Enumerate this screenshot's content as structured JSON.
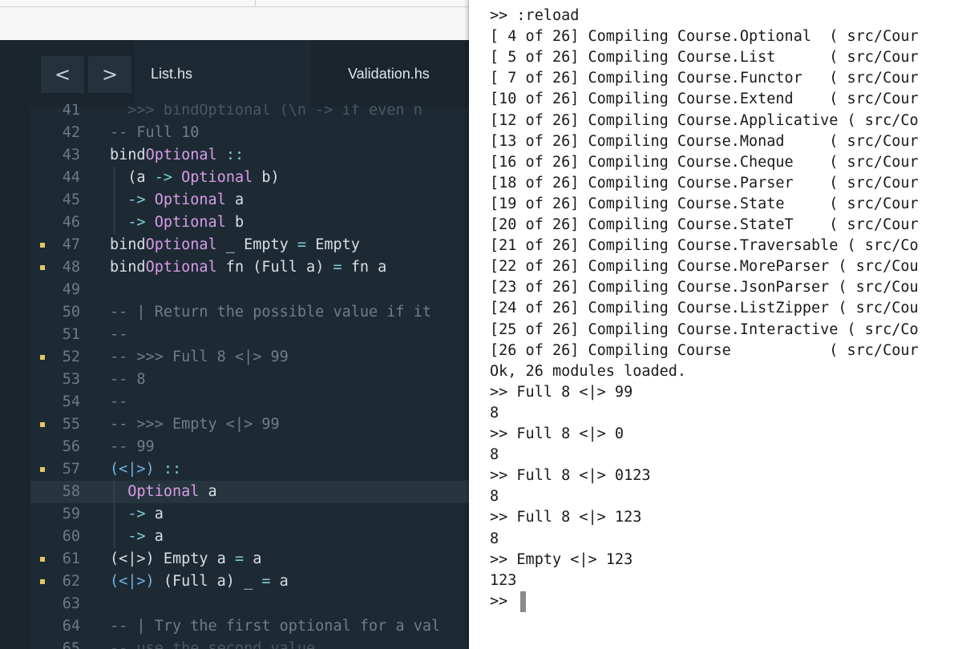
{
  "editor": {
    "nav": {
      "back": "<",
      "forward": ">"
    },
    "tabs": [
      {
        "label": "List.hs",
        "active": true
      },
      {
        "label": "Validation.hs",
        "active": false
      }
    ],
    "lines": [
      {
        "n": "41",
        "text": "  >>> bindOptional (\\n -> if even n",
        "partial": true
      },
      {
        "n": "42",
        "text": "-- Full 10"
      },
      {
        "n": "43",
        "text": "bindOptional ::"
      },
      {
        "n": "44",
        "text": "  (a -> Optional b)"
      },
      {
        "n": "45",
        "text": "  -> Optional a"
      },
      {
        "n": "46",
        "text": "  -> Optional b"
      },
      {
        "n": "47",
        "text": "bindOptional _ Empty = Empty",
        "mark": true
      },
      {
        "n": "48",
        "text": "bindOptional fn (Full a) = fn a",
        "mark": true
      },
      {
        "n": "49",
        "text": ""
      },
      {
        "n": "50",
        "text": "-- | Return the possible value if it"
      },
      {
        "n": "51",
        "text": "--"
      },
      {
        "n": "52",
        "text": "-- >>> Full 8 <|> 99",
        "mark": true
      },
      {
        "n": "53",
        "text": "-- 8"
      },
      {
        "n": "54",
        "text": "--"
      },
      {
        "n": "55",
        "text": "-- >>> Empty <|> 99",
        "mark": true
      },
      {
        "n": "56",
        "text": "-- 99"
      },
      {
        "n": "57",
        "text": "(<|>) ::",
        "mark": true
      },
      {
        "n": "58",
        "text": "  Optional a",
        "active": true
      },
      {
        "n": "59",
        "text": "  -> a"
      },
      {
        "n": "60",
        "text": "  -> a"
      },
      {
        "n": "61",
        "text": "(<|>) Empty a = a",
        "mark": true
      },
      {
        "n": "62",
        "text": "(<|>) (Full a) _ = a",
        "mark": true
      },
      {
        "n": "63",
        "text": ""
      },
      {
        "n": "64",
        "text": "-- | Try the first optional for a val"
      },
      {
        "n": "65",
        "text": "-- use the second value",
        "partial": true
      }
    ]
  },
  "terminal": {
    "lines": [
      ">> :reload",
      "[ 4 of 26] Compiling Course.Optional  ( src/Cour",
      "[ 5 of 26] Compiling Course.List      ( src/Cour",
      "[ 7 of 26] Compiling Course.Functor   ( src/Cour",
      "[10 of 26] Compiling Course.Extend    ( src/Cour",
      "[12 of 26] Compiling Course.Applicative ( src/Co",
      "[13 of 26] Compiling Course.Monad     ( src/Cour",
      "[16 of 26] Compiling Course.Cheque    ( src/Cour",
      "[18 of 26] Compiling Course.Parser    ( src/Cour",
      "[19 of 26] Compiling Course.State     ( src/Cour",
      "[20 of 26] Compiling Course.StateT    ( src/Cour",
      "[21 of 26] Compiling Course.Traversable ( src/Co",
      "[22 of 26] Compiling Course.MoreParser ( src/Cou",
      "[23 of 26] Compiling Course.JsonParser ( src/Cou",
      "[24 of 26] Compiling Course.ListZipper ( src/Cou",
      "[25 of 26] Compiling Course.Interactive ( src/Co",
      "[26 of 26] Compiling Course           ( src/Cour",
      "Ok, 26 modules loaded.",
      ">> Full 8 <|> 99",
      "8",
      ">> Full 8 <|> 0",
      "8",
      ">> Full 8 <|> 0123",
      "8",
      ">> Full 8 <|> 123",
      "8",
      ">> Empty <|> 123",
      "123",
      ">> "
    ]
  },
  "colors": {
    "editor_bg": "#1e2a33",
    "comment": "#6f7d87",
    "function": "#6fb3e8",
    "type": "#d79ce8",
    "operator": "#7ecdd6",
    "modified_marker": "#e7c462",
    "terminal_bg": "#ffffff"
  },
  "icons": [
    "chevron-left-icon",
    "chevron-right-icon",
    "modified-line-marker-icon",
    "terminal-cursor"
  ]
}
